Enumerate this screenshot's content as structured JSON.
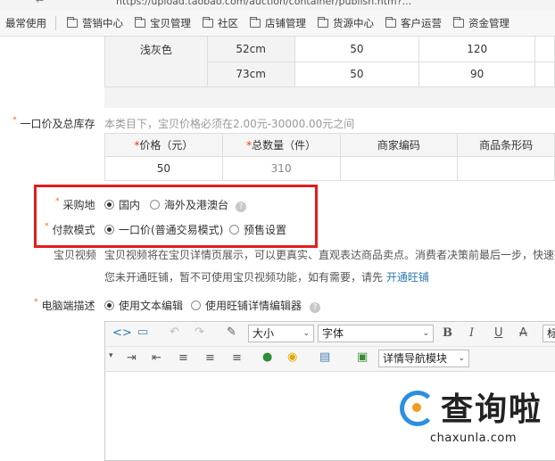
{
  "browser": {
    "url": "https://upload.taobao.com/auction/container/publish.htm?..."
  },
  "bookmarks": {
    "first": "最常使用",
    "items": [
      "营销中心",
      "宝贝管理",
      "社区",
      "店铺管理",
      "货源中心",
      "客户运营",
      "资金管理"
    ]
  },
  "sku_table": {
    "color": "浅灰色",
    "rows": [
      {
        "size": "52cm",
        "qty": "50",
        "price": "120"
      },
      {
        "size": "73cm",
        "qty": "50",
        "price": "90"
      }
    ]
  },
  "price_section": {
    "label": "一口价及总库存",
    "hint": "本类目下，宝贝价格必须在2.00元-30000.00元之间",
    "headers": [
      "价格（元）",
      "总数量（件）",
      "商家编码",
      "商品条形码"
    ],
    "price_value": "50",
    "qty_value": "310"
  },
  "purchase_location": {
    "label": "采购地",
    "options": [
      "国内",
      "海外及港澳台"
    ],
    "selected": "国内"
  },
  "payment_mode": {
    "label": "付款模式",
    "options": [
      "一口价(普通交易模式)",
      "预售设置"
    ],
    "selected": "一口价(普通交易模式)"
  },
  "video": {
    "label": "宝贝视频",
    "line1": "宝贝视频将在宝贝详情页展示，可以更真实、直观表达商品卖点。消费者决策前最后一步，快速提",
    "line2_prefix": "您未开通旺铺，暂不可使用宝贝视频功能，如有需要，请先",
    "line2_link": "开通旺铺"
  },
  "pc_desc": {
    "label": "电脑端描述",
    "options": [
      "使用文本编辑",
      "使用旺铺详情编辑器"
    ],
    "selected": "使用文本编辑"
  },
  "editor": {
    "size_label": "大小",
    "font_label": "字体",
    "bold": "B",
    "italic": "I",
    "underline": "U",
    "strike": "A",
    "cut_label": "标",
    "nav_module": "详情导航模块"
  },
  "watermark": {
    "brand": "查询啦",
    "domain": "chaxunla.com"
  },
  "colors": {
    "highlight_box": "#e21d1d",
    "required_star": "#ff6600",
    "link": "#2a7ab0"
  }
}
